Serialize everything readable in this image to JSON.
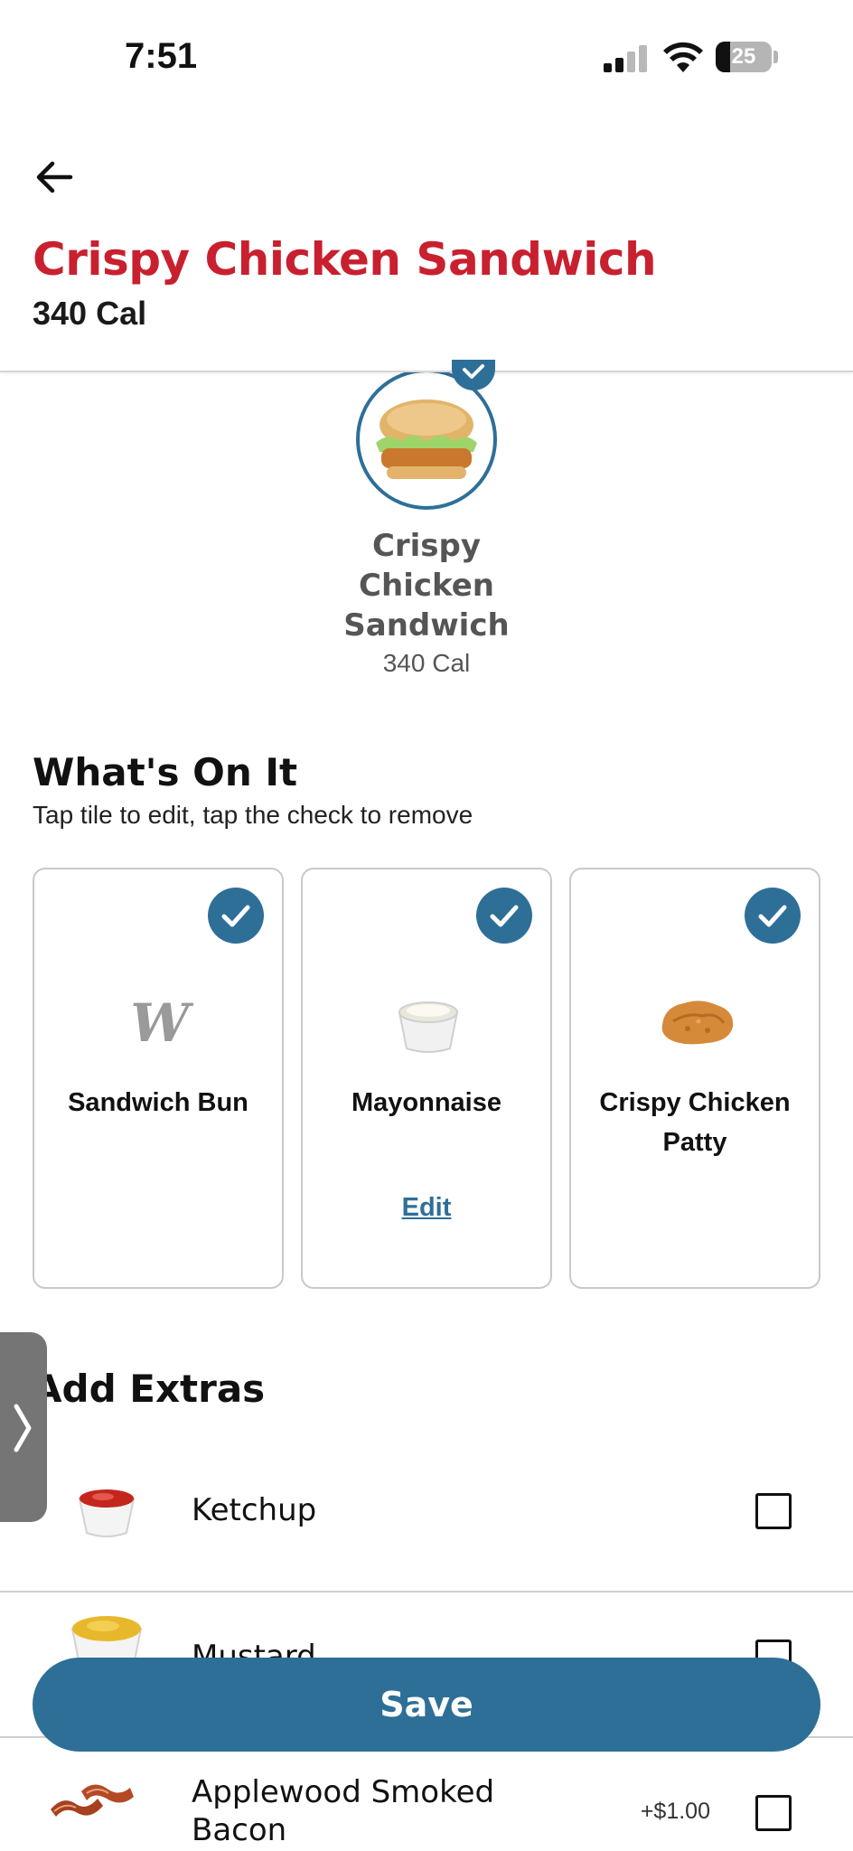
{
  "status_bar": {
    "time": "7:51",
    "battery": "25",
    "battery_level": 0.25
  },
  "header": {
    "title": "Crispy Chicken Sandwich",
    "calories": "340 Cal"
  },
  "product": {
    "name_lines": [
      "Crispy",
      "Chicken",
      "Sandwich"
    ],
    "calories": "340 Cal"
  },
  "whats_on_it": {
    "title": "What's On It",
    "subtitle": "Tap tile to edit, tap the check to remove",
    "items": [
      {
        "label": "Sandwich Bun",
        "checked": true,
        "icon": "bun-logo-icon"
      },
      {
        "label": "Mayonnaise",
        "checked": true,
        "edit_label": "Edit",
        "icon": "mayonnaise-cup-icon"
      },
      {
        "label": "Crispy Chicken Patty",
        "checked": true,
        "icon": "chicken-patty-icon"
      }
    ]
  },
  "extras": {
    "title": "Add Extras",
    "items": [
      {
        "label": "Ketchup",
        "price": "",
        "checked": false,
        "icon": "ketchup-cup-icon"
      },
      {
        "label": "Mustard",
        "price": "",
        "checked": false,
        "icon": "mustard-cup-icon"
      },
      {
        "label_lines": [
          "Applewood Smoked",
          "Bacon"
        ],
        "price": "+$1.00",
        "checked": false,
        "icon": "bacon-icon"
      }
    ]
  },
  "save_label": "Save",
  "colors": {
    "brand_red": "#c8202f",
    "accent_blue": "#2e6f98"
  }
}
